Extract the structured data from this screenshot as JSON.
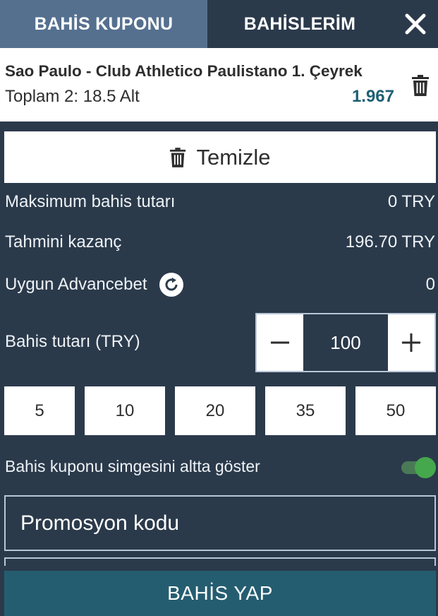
{
  "tabs": [
    {
      "label": "BAHİS KUPONU",
      "active": true
    },
    {
      "label": "BAHİSLERİM",
      "active": false
    }
  ],
  "bet": {
    "match": "Sao Paulo - Club Athletico Paulistano 1. Çeyrek",
    "market": "Toplam 2: 18.5 Alt",
    "odd": "1.967"
  },
  "clear_label": "Temizle",
  "rows": {
    "max_stake": {
      "label": "Maksimum bahis tutarı",
      "value": "0 TRY"
    },
    "est_win": {
      "label": "Tahmini kazanç",
      "value": "196.70 TRY"
    },
    "advancebet": {
      "label": "Uygun Advancebet",
      "value": "0"
    }
  },
  "stake": {
    "label": "Bahis tutarı (TRY)",
    "value": "100"
  },
  "quick_amounts": [
    "5",
    "10",
    "20",
    "35",
    "50"
  ],
  "toggle": {
    "label": "Bahis kuponu simgesini altta göster",
    "on": true
  },
  "promo_placeholder": "Promosyon kodu",
  "place_label": "BAHİS YAP",
  "colors": {
    "background": "#2b3a4b",
    "active_tab": "#55708f",
    "odd": "#1f5f74",
    "toggle_on": "#45a84d",
    "place_button": "#255d70"
  }
}
